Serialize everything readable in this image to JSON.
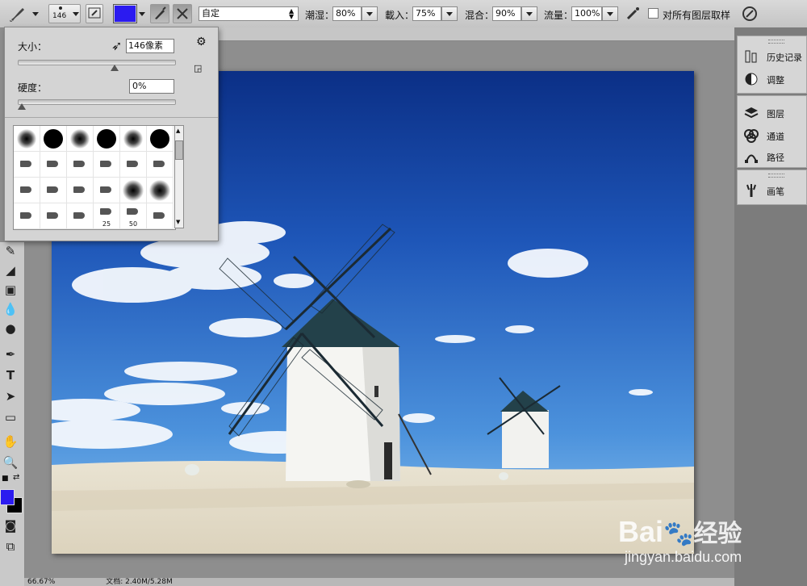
{
  "options_bar": {
    "brush_size_preview": "146",
    "brush_color": "#2b1bf0",
    "mode_value": "自定",
    "opacity_label": "潮湿：",
    "opacity_value": "80%",
    "load_label": "載入：",
    "load_value": "75%",
    "mix_label": "混合：",
    "mix_value": "90%",
    "flow_label": "流量：",
    "flow_value": "100%",
    "sample_all_label": "对所有图层取样"
  },
  "brush_popup": {
    "size_label": "大小：",
    "size_value": "146",
    "size_unit": "像素",
    "size_fraction": 0.62,
    "hardness_label": "硬度：",
    "hardness_value": "0%",
    "hardness_fraction": 0.0,
    "preset_numbers": [
      "25",
      "50"
    ]
  },
  "panels": {
    "group1": [
      {
        "icon": "history-icon",
        "label": "历史记录"
      },
      {
        "icon": "adjustments-icon",
        "label": "调整"
      }
    ],
    "group2": [
      {
        "icon": "layers-icon",
        "label": "图层"
      },
      {
        "icon": "channels-icon",
        "label": "通道"
      },
      {
        "icon": "paths-icon",
        "label": "路径"
      }
    ],
    "group3": [
      {
        "icon": "brush-panel-icon",
        "label": "画笔"
      }
    ]
  },
  "status": {
    "zoom": "66.67%",
    "doc_info": "文档: 2.40M/5.28M"
  },
  "colors": {
    "foreground": "#2b1bf0",
    "background": "#000000"
  },
  "watermark": {
    "brand": "Bai",
    "brand_suffix": "经验",
    "url": "jingyan.baidu.com"
  }
}
